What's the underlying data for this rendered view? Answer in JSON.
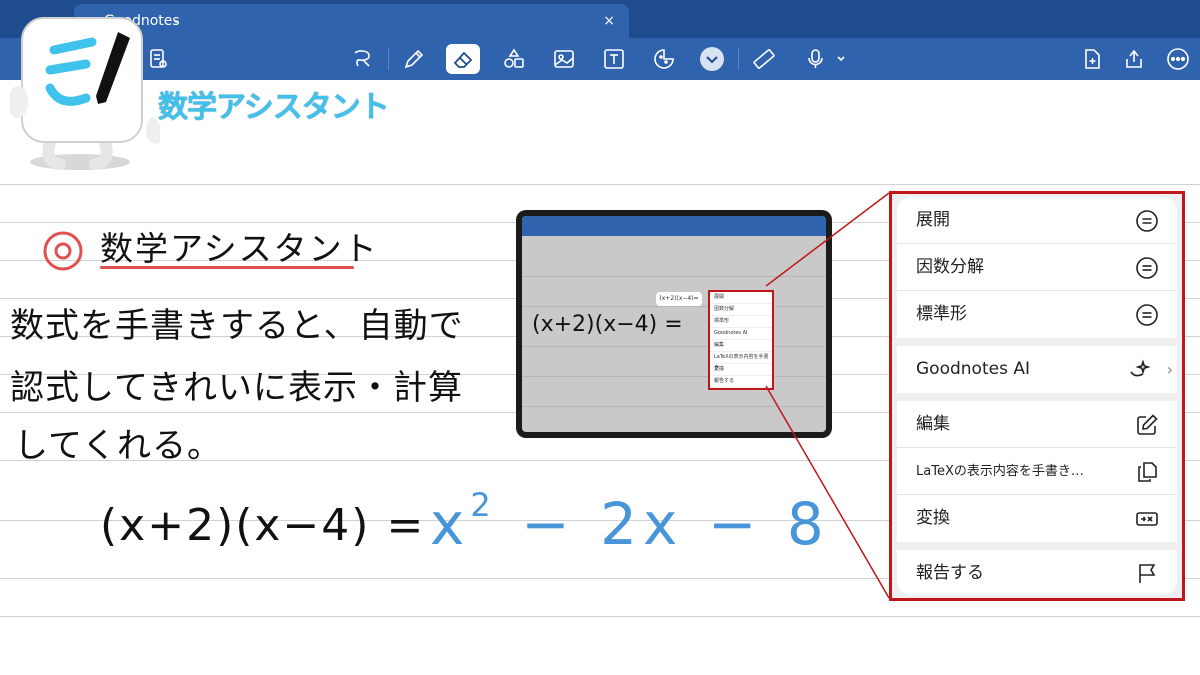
{
  "app": {
    "tab_title": "Goodnotes",
    "tab_chevron": "⌄",
    "tab_close": "×"
  },
  "toolbar": {
    "icons": [
      "library-icon",
      "grid-icon",
      "doc-settings-icon",
      "lasso-icon",
      "pen-icon",
      "eraser-icon",
      "shapes-icon",
      "image-icon",
      "text-icon",
      "sticker-icon",
      "more-tools-icon",
      "ruler-icon",
      "mic-icon",
      "add-page-icon",
      "share-icon",
      "more-icon"
    ],
    "active_tool": "eraser"
  },
  "header": {
    "title": "数学アシスタント"
  },
  "note": {
    "section_title": "数学アシスタント",
    "body_lines": [
      "数式を手書きすると、自動で",
      "認式してきれいに表示・計算",
      "してくれる。"
    ],
    "equation_left": "(x+2)(x−4) =",
    "equation_result_base": "x",
    "equation_result_exp": "2",
    "equation_result_rest": " − 2x − 8"
  },
  "ipad_preview": {
    "pill_text": "(x+2)(x−4)=",
    "equation": "(x+2)(x−4) =",
    "menu_items": [
      "展開",
      "因数分解",
      "標準形",
      "Goodnotes AI",
      "編集",
      "LaTeXの表示内容を手書き…",
      "変換",
      "報告する"
    ]
  },
  "menu": {
    "items": [
      {
        "label": "展開",
        "icon": "equals-circle-icon"
      },
      {
        "label": "因数分解",
        "icon": "equals-circle-icon"
      },
      {
        "label": "標準形",
        "icon": "equals-circle-icon"
      },
      {
        "label": "Goodnotes AI",
        "icon": "ai-sparkle-icon",
        "chevron": "›"
      },
      {
        "label": "編集",
        "icon": "edit-icon"
      },
      {
        "label": "LaTeXの表示内容を手書き…",
        "icon": "copy-icon"
      },
      {
        "label": "変換",
        "icon": "convert-icon"
      },
      {
        "label": "報告する",
        "icon": "flag-icon"
      }
    ]
  },
  "colors": {
    "toolbar_bg": "#2f63ad",
    "topbar_bg": "#1f4c8f",
    "highlight_red": "#c0161b",
    "result_blue": "#4896d9",
    "title_cyan": "#3fc3ec"
  }
}
